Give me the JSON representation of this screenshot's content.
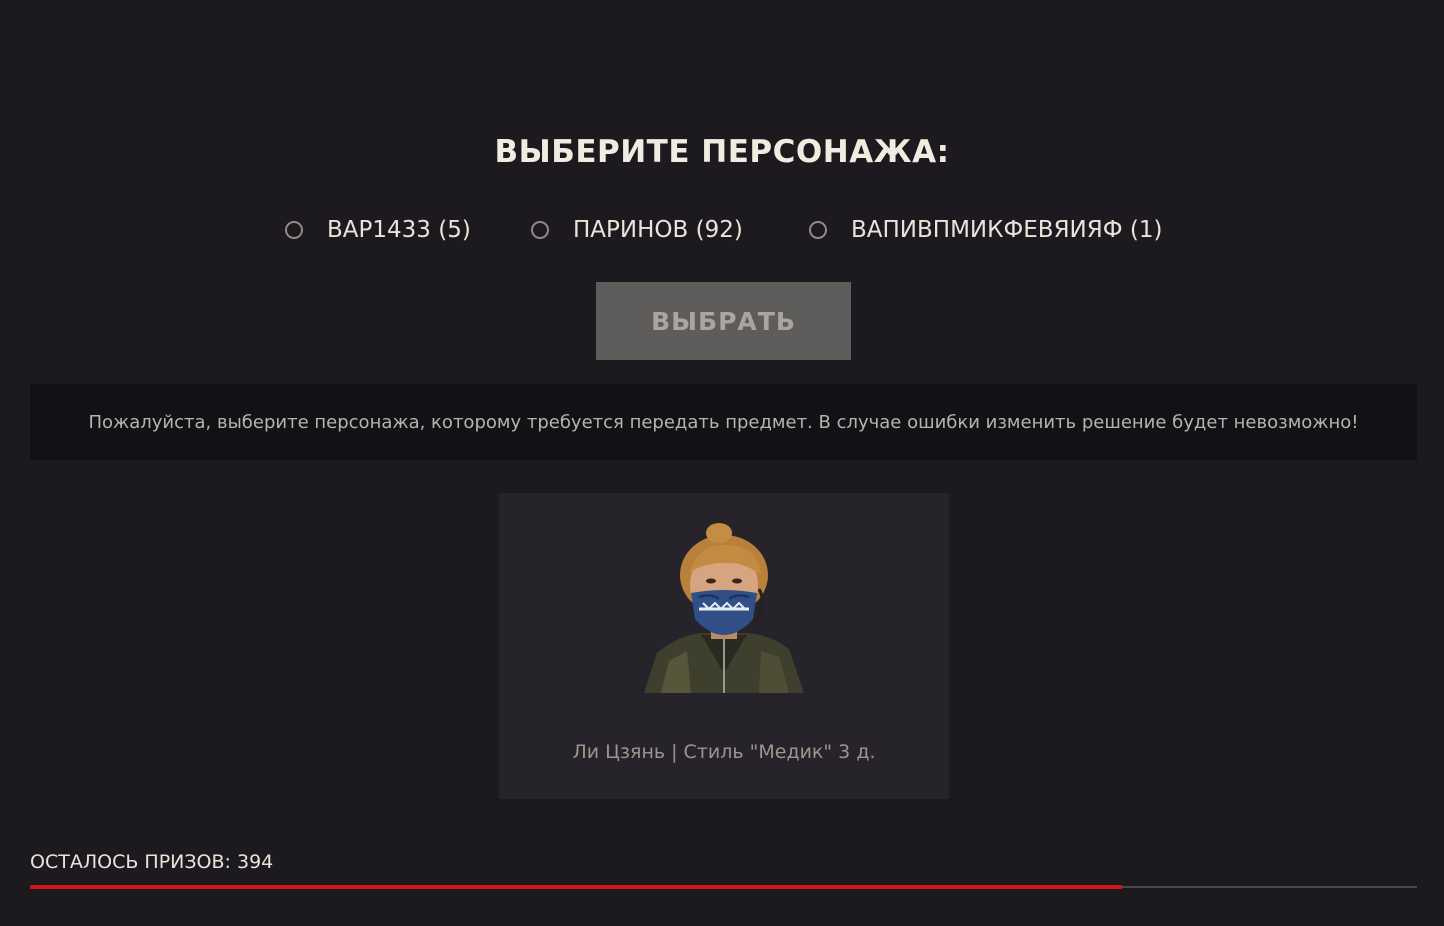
{
  "header": {
    "title": "ВЫБЕРИТЕ ПЕРСОНАЖА:"
  },
  "characters": [
    {
      "label": "BAP1433 (5)",
      "selected": false
    },
    {
      "label": "ПАРИНОВ (92)",
      "selected": false
    },
    {
      "label": "ВАПИВПМИКФЕВЯИЯФ (1)",
      "selected": false
    }
  ],
  "actions": {
    "select_label": "ВЫБРАТЬ"
  },
  "notice": {
    "text": "Пожалуйста, выберите персонажа, которому требуется передать предмет. В случае ошибки изменить решение будет невозможно!"
  },
  "item": {
    "name": "Ли Цзянь | Стиль \"Медик\" 3 д.",
    "image_icon": "character-portrait-icon"
  },
  "prizes": {
    "label": "ОСТАЛОСЬ ПРИЗОВ: 394",
    "progress_fraction": 0.787
  },
  "colors": {
    "background": "#1c1a1f",
    "accent": "#d0141a",
    "button_disabled": "#5f5d5b",
    "card": "#26242a"
  }
}
